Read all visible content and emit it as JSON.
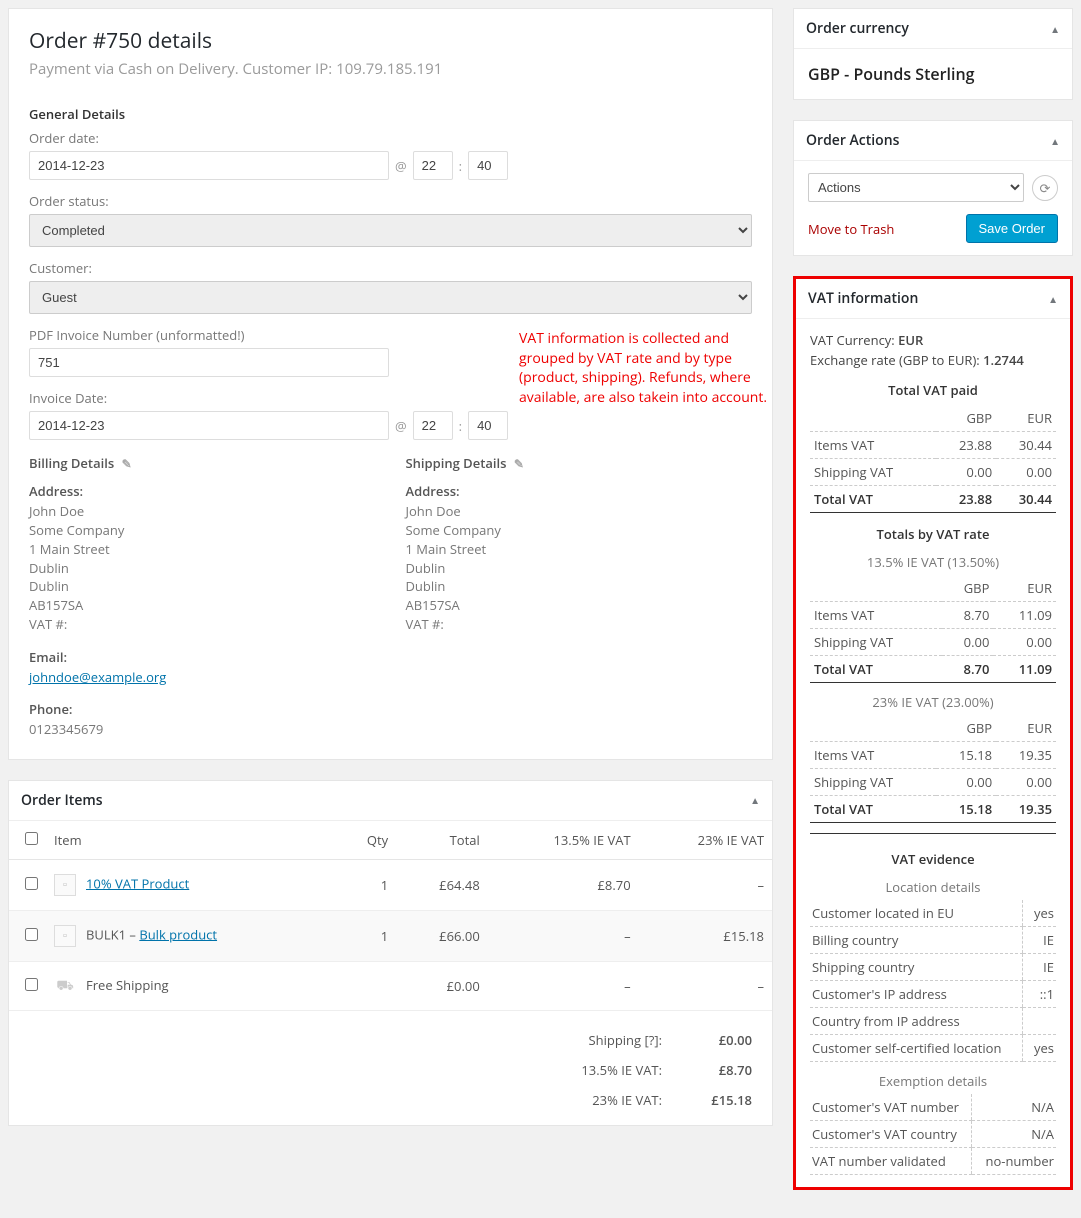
{
  "order": {
    "title": "Order #750 details",
    "subtitle": "Payment via Cash on Delivery. Customer IP: 109.79.185.191",
    "general_details_label": "General Details",
    "order_date_label": "Order date:",
    "order_date": "2014-12-23",
    "at_sep": "@",
    "colon": ":",
    "order_hour": "22",
    "order_min": "40",
    "order_status_label": "Order status:",
    "order_status": "Completed",
    "customer_label": "Customer:",
    "customer": "Guest",
    "invoice_num_label": "PDF Invoice Number (unformatted!)",
    "invoice_num": "751",
    "invoice_date_label": "Invoice Date:",
    "invoice_date": "2014-12-23",
    "invoice_hour": "22",
    "invoice_min": "40"
  },
  "billing": {
    "title": "Billing Details",
    "address_label": "Address:",
    "lines": [
      "John Doe",
      "Some Company",
      "1 Main Street",
      "Dublin",
      "Dublin",
      "AB157SA",
      "VAT #:"
    ],
    "email_label": "Email:",
    "email": "johndoe@example.org",
    "phone_label": "Phone:",
    "phone": "0123345679"
  },
  "shipping": {
    "title": "Shipping Details",
    "address_label": "Address:",
    "lines": [
      "John Doe",
      "Some Company",
      "1 Main Street",
      "Dublin",
      "Dublin",
      "AB157SA",
      "VAT #:"
    ]
  },
  "annotation": "VAT information is collected and grouped by VAT rate and by type (product, shipping). Refunds, where available, are also takein into account.",
  "items_panel": {
    "title": "Order Items",
    "columns": {
      "item": "Item",
      "qty": "Qty",
      "total": "Total",
      "vat1": "13.5% IE VAT",
      "vat2": "23% IE VAT"
    },
    "rows": [
      {
        "name": "10% VAT Product",
        "link": true,
        "prefix": "",
        "qty": "1",
        "total": "£64.48",
        "vat1": "£8.70",
        "vat2": "–",
        "icon": "box"
      },
      {
        "name": "Bulk product",
        "link": true,
        "prefix": "BULK1 – ",
        "qty": "1",
        "total": "£66.00",
        "vat1": "–",
        "vat2": "£15.18",
        "icon": "box"
      },
      {
        "name": "Free Shipping",
        "link": false,
        "prefix": "",
        "qty": "",
        "total": "£0.00",
        "vat1": "–",
        "vat2": "–",
        "icon": "truck"
      }
    ],
    "totals": [
      {
        "label": "Shipping [?]:",
        "value": "£0.00"
      },
      {
        "label": "13.5% IE VAT:",
        "value": "£8.70"
      },
      {
        "label": "23% IE VAT:",
        "value": "£15.18"
      }
    ]
  },
  "sidebar": {
    "currency_title": "Order currency",
    "currency_value": "GBP - Pounds Sterling",
    "actions_title": "Order Actions",
    "actions_placeholder": "Actions",
    "move_trash": "Move to Trash",
    "save_order": "Save Order"
  },
  "vat": {
    "title": "VAT information",
    "currency_label": "VAT Currency:",
    "currency": "EUR",
    "exch_label": "Exchange rate (GBP to EUR):",
    "exch": "1.2744",
    "total_paid_head": "Total VAT paid",
    "col_gbp": "GBP",
    "col_eur": "EUR",
    "rows_total": [
      {
        "label": "Items VAT",
        "gbp": "23.88",
        "eur": "30.44"
      },
      {
        "label": "Shipping VAT",
        "gbp": "0.00",
        "eur": "0.00"
      }
    ],
    "total_row": {
      "label": "Total VAT",
      "gbp": "23.88",
      "eur": "30.44"
    },
    "by_rate_head": "Totals by VAT rate",
    "rates": [
      {
        "head": "13.5% IE VAT (13.50%)",
        "rows": [
          {
            "label": "Items VAT",
            "gbp": "8.70",
            "eur": "11.09"
          },
          {
            "label": "Shipping VAT",
            "gbp": "0.00",
            "eur": "0.00"
          }
        ],
        "total": {
          "label": "Total VAT",
          "gbp": "8.70",
          "eur": "11.09"
        }
      },
      {
        "head": "23% IE VAT (23.00%)",
        "rows": [
          {
            "label": "Items VAT",
            "gbp": "15.18",
            "eur": "19.35"
          },
          {
            "label": "Shipping VAT",
            "gbp": "0.00",
            "eur": "0.00"
          }
        ],
        "total": {
          "label": "Total VAT",
          "gbp": "15.18",
          "eur": "19.35"
        }
      }
    ],
    "evidence_head": "VAT evidence",
    "location_head": "Location details",
    "location_rows": [
      {
        "label": "Customer located in EU",
        "value": "yes"
      },
      {
        "label": "Billing country",
        "value": "IE"
      },
      {
        "label": "Shipping country",
        "value": "IE"
      },
      {
        "label": "Customer's IP address",
        "value": "::1"
      },
      {
        "label": "Country from IP address",
        "value": ""
      },
      {
        "label": "Customer self-certified location",
        "value": "yes"
      }
    ],
    "exemption_head": "Exemption details",
    "exemption_rows": [
      {
        "label": "Customer's VAT number",
        "value": "N/A"
      },
      {
        "label": "Customer's VAT country",
        "value": "N/A"
      },
      {
        "label": "VAT number validated",
        "value": "no-number"
      }
    ]
  }
}
